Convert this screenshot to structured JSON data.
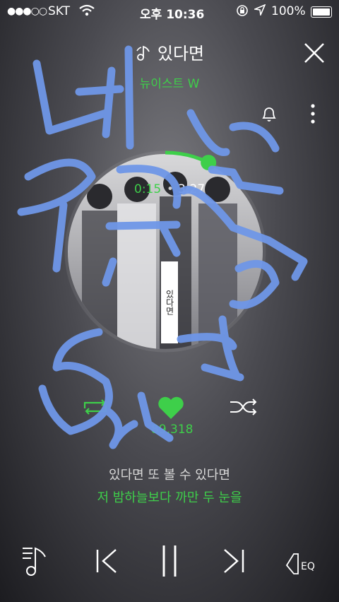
{
  "status_bar": {
    "signal": "●●●○○",
    "carrier": "SKT",
    "time": "오후 10:36",
    "battery": "100%"
  },
  "header": {
    "title": "있다면",
    "artist": "뉴이스트 W"
  },
  "player": {
    "elapsed": "0:15",
    "duration": "3:27",
    "progress": 0.072,
    "album_text": "있다면",
    "likes": "89,318"
  },
  "lyrics": {
    "previous_line": "있다면 또 볼 수 있다면",
    "current_line": "저 밤하늘보다 까만 두 눈을"
  },
  "colors": {
    "accent": "#3ecf4a",
    "scribble": "#6f97e8"
  },
  "icons": [
    "music-note-icon",
    "close-icon",
    "bell-icon",
    "more-icon",
    "repeat-icon",
    "heart-icon",
    "shuffle-icon",
    "playlist-icon",
    "previous-icon",
    "pause-icon",
    "next-icon",
    "eq-icon"
  ]
}
